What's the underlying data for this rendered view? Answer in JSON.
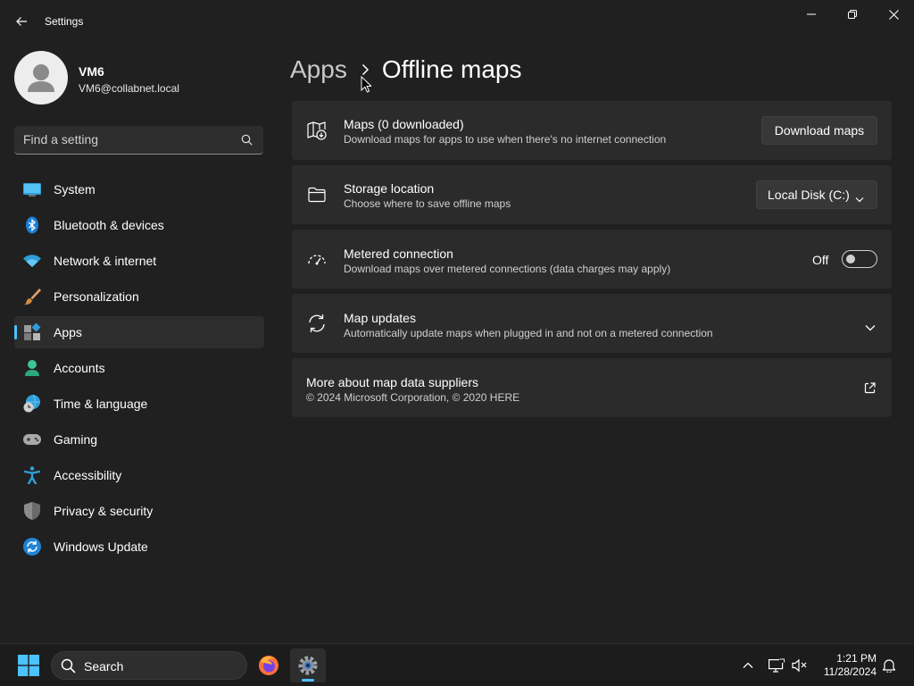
{
  "window": {
    "title": "Settings"
  },
  "profile": {
    "name": "VM6",
    "email": "VM6@collabnet.local"
  },
  "search": {
    "placeholder": "Find a setting"
  },
  "nav": {
    "items": [
      {
        "label": "System",
        "icon": "monitor-icon"
      },
      {
        "label": "Bluetooth & devices",
        "icon": "bluetooth-icon"
      },
      {
        "label": "Network & internet",
        "icon": "wifi-icon"
      },
      {
        "label": "Personalization",
        "icon": "brush-icon"
      },
      {
        "label": "Apps",
        "icon": "apps-icon",
        "active": true
      },
      {
        "label": "Accounts",
        "icon": "person-icon"
      },
      {
        "label": "Time & language",
        "icon": "globe-clock-icon"
      },
      {
        "label": "Gaming",
        "icon": "gamepad-icon"
      },
      {
        "label": "Accessibility",
        "icon": "accessibility-icon"
      },
      {
        "label": "Privacy & security",
        "icon": "shield-icon"
      },
      {
        "label": "Windows Update",
        "icon": "update-icon"
      }
    ]
  },
  "breadcrumb": {
    "parent": "Apps",
    "current": "Offline maps"
  },
  "cards": {
    "maps": {
      "title": "Maps (0 downloaded)",
      "desc": "Download maps for apps to use when there's no internet connection",
      "button": "Download maps"
    },
    "storage": {
      "title": "Storage location",
      "desc": "Choose where to save offline maps",
      "selected": "Local Disk (C:)"
    },
    "metered": {
      "title": "Metered connection",
      "desc": "Download maps over metered connections (data charges may apply)",
      "toggle_label": "Off",
      "toggle_on": false
    },
    "updates": {
      "title": "Map updates",
      "desc": "Automatically update maps when plugged in and not on a metered connection"
    },
    "suppliers": {
      "title": "More about map data suppliers",
      "desc": "© 2024 Microsoft Corporation, © 2020 HERE"
    }
  },
  "taskbar": {
    "search_label": "Search",
    "time": "1:21 PM",
    "date": "11/28/2024"
  },
  "colors": {
    "accent": "#4cc2ff",
    "background": "#202020",
    "card": "#2b2b2b"
  }
}
